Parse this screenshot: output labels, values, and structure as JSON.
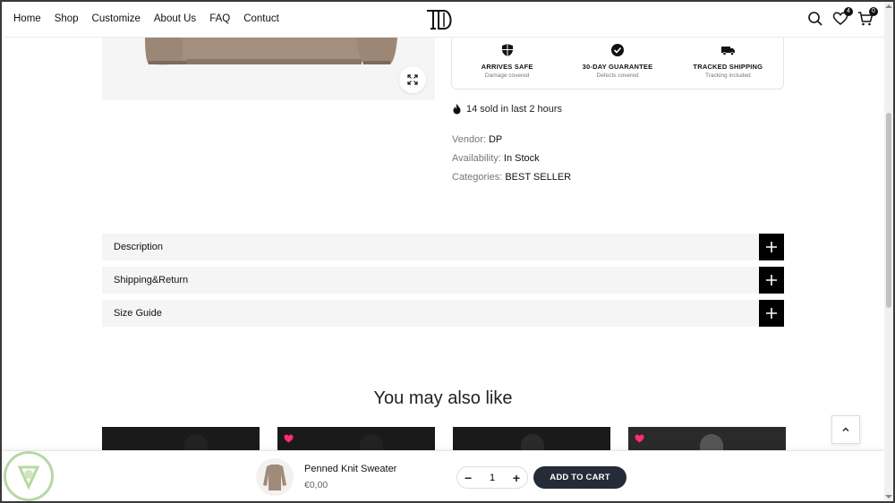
{
  "nav": {
    "items": [
      "Home",
      "Shop",
      "Customize",
      "About Us",
      "FAQ",
      "Contuct"
    ]
  },
  "header": {
    "logo_text": "DP",
    "wishlist_count": "4",
    "cart_count": "0"
  },
  "trust": [
    {
      "icon": "shield-icon",
      "title": "ARRIVES SAFE",
      "sub": "Damage covered"
    },
    {
      "icon": "check-circle-icon",
      "title": "30-DAY GUARANTEE",
      "sub": "Defects covered"
    },
    {
      "icon": "truck-icon",
      "title": "TRACKED SHIPPING",
      "sub": "Tracking included"
    }
  ],
  "sold_text": "14 sold in last 2 hours",
  "meta": {
    "vendor_label": "Vendor:",
    "vendor": "DP",
    "availability_label": "Availability:",
    "availability": "In Stock",
    "categories_label": "Categories:",
    "categories": "BEST SELLER"
  },
  "accordion": [
    "Description",
    "Shipping&Return",
    "Size Guide"
  ],
  "also_like_title": "You may also like",
  "sticky": {
    "product_name": "Penned Knit Sweater",
    "price": "€0,00",
    "quantity": "1",
    "add_to_cart": "ADD TO CART"
  },
  "colors": {
    "accent_dark": "#262b38",
    "heart": "#ff2d6f"
  }
}
